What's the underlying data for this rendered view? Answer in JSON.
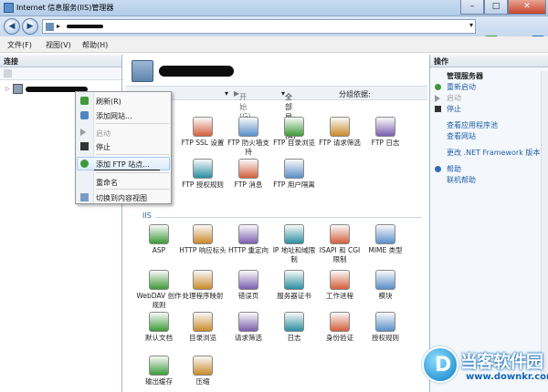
{
  "window": {
    "title": "Internet 信息服务(IIS)管理器"
  },
  "address": {
    "root_segment": "▸"
  },
  "menu": {
    "file": "文件(F)",
    "view": "视图(V)",
    "help": "帮助(H)"
  },
  "connections": {
    "title": "连接"
  },
  "filter": {
    "start": "开始(G)",
    "show_all": "全部显示(A)",
    "group_by": "分组依据:"
  },
  "ftp_items": [
    {
      "label": "FTP SSL 设置",
      "icon": "ftp-ssl-icon"
    },
    {
      "label": "FTP 防火墙支持",
      "icon": "ftp-firewall-icon"
    },
    {
      "label": "FTP 目录浏览",
      "icon": "ftp-directory-browsing-icon"
    },
    {
      "label": "FTP 请求筛选",
      "icon": "ftp-request-filtering-icon"
    },
    {
      "label": "FTP 日志",
      "icon": "ftp-logging-icon"
    },
    {
      "label": "FTP 授权规则",
      "icon": "ftp-authorization-icon"
    },
    {
      "label": "FTP 消息",
      "icon": "ftp-messages-icon"
    },
    {
      "label": "FTP 用户隔离",
      "icon": "ftp-user-isolation-icon"
    }
  ],
  "ftp_partial": {
    "row1": "证",
    "row2": "验证"
  },
  "iis_section": "IIS",
  "iis_items": [
    {
      "label": "ASP",
      "icon": "asp-icon"
    },
    {
      "label": "HTTP 响应标头",
      "icon": "http-response-headers-icon"
    },
    {
      "label": "HTTP 重定向",
      "icon": "http-redirect-icon"
    },
    {
      "label": "IP 地址和域限制",
      "icon": "ip-domain-restrictions-icon"
    },
    {
      "label": "ISAPI 和 CGI 限制",
      "icon": "isapi-cgi-icon"
    },
    {
      "label": "MIME 类型",
      "icon": "mime-types-icon"
    },
    {
      "label": "WebDAV 创作规则",
      "icon": "webdav-icon"
    },
    {
      "label": "处理程序映射",
      "icon": "handler-mappings-icon"
    },
    {
      "label": "错误页",
      "icon": "error-pages-icon"
    },
    {
      "label": "服务器证书",
      "icon": "server-certificates-icon"
    },
    {
      "label": "工作进程",
      "icon": "worker-processes-icon"
    },
    {
      "label": "模块",
      "icon": "modules-icon"
    },
    {
      "label": "默认文档",
      "icon": "default-document-icon"
    },
    {
      "label": "目录浏览",
      "icon": "directory-browsing-icon"
    },
    {
      "label": "请求筛选",
      "icon": "request-filtering-icon"
    },
    {
      "label": "日志",
      "icon": "logging-icon"
    },
    {
      "label": "身份验证",
      "icon": "authentication-icon"
    },
    {
      "label": "授权规则",
      "icon": "authorization-rules-icon"
    },
    {
      "label": "输出缓存",
      "icon": "output-caching-icon"
    },
    {
      "label": "压缩",
      "icon": "compression-icon"
    }
  ],
  "actions": {
    "title": "操作",
    "manage_server": "管理服务器",
    "restart": "重新启动",
    "start": "启动",
    "stop": "停止",
    "view_app_pools": "查看应用程序池",
    "view_sites": "查看网站",
    "change_net": "更改 .NET Framework 版本",
    "help": "帮助",
    "online_help": "联机帮助"
  },
  "context_menu": {
    "refresh": "刷新(R)",
    "add_site": "添加网站...",
    "start": "启动",
    "stop": "停止",
    "add_ftp": "添加 FTP 站点...",
    "rename": "重命名",
    "switch_view": "切换到内容视图"
  },
  "watermark": {
    "logo_letter": "D",
    "brand": "当客软件园",
    "url": "www.downkr.com"
  },
  "colors": {
    "accent": "#2a64a8",
    "link": "#1f5fa8",
    "title_bg": "#c9dcf0"
  }
}
